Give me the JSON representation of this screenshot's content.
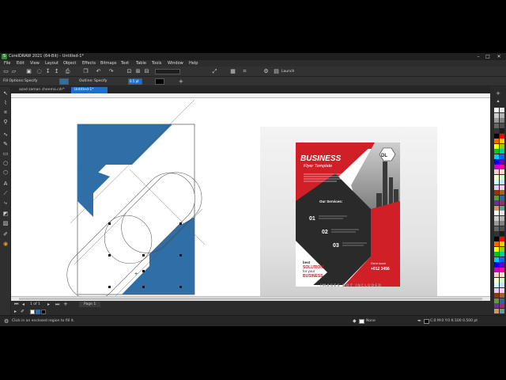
{
  "window": {
    "title": "CorelDRAW 2021 (64-Bit) - Untitled-1*",
    "logo_letter": "S",
    "controls": [
      "–",
      "□",
      "✕"
    ]
  },
  "menu": [
    "File",
    "Edit",
    "View",
    "Layout",
    "Object",
    "Effects",
    "Bitmaps",
    "Text",
    "Table",
    "Tools",
    "Window",
    "Help"
  ],
  "standard_toolbar": {
    "zoom_value": "",
    "launch_label": "Launch"
  },
  "property_bar": {
    "fill_options_label": "Fill Options:",
    "fill_value": "Specify",
    "outline_label": "Outline:",
    "outline_value": "Specify",
    "outline_width": "0.5 pt",
    "fill_color": "#2f6ea6",
    "outline_color": "#000000"
  },
  "tabs": [
    {
      "label": "azad zaman cheema.cdr*",
      "active": false
    },
    {
      "label": "Untitled-1*",
      "active": true
    }
  ],
  "flyer": {
    "title": "BUSINESS",
    "subtitle": "Flyer Template",
    "logo": "DL",
    "services_heading": "Our Services:",
    "numbers": [
      "01",
      "02",
      "03"
    ],
    "best_word": "best",
    "solution_word": "SOLUTION",
    "for_your": "for your",
    "business_word": "BUSINESS",
    "get_in_touch": "Get in touch",
    "phone": "+012 3456"
  },
  "watermark": "IMAGES NOT INCLUDED",
  "page_nav": {
    "page_counter": "1  of  1",
    "page_tab": "Page 1"
  },
  "status": {
    "hint": "Click in an enclosed region to fill it.",
    "fill_state": "None",
    "color_readout": "C:0 M:0 Y:0 K:100  0.500 pt"
  },
  "colors": {
    "accent_blue": "#2f6ea6",
    "flyer_red": "#d11f28",
    "flyer_dark": "#2a2a2a",
    "app_bg": "#2b2b2b"
  }
}
